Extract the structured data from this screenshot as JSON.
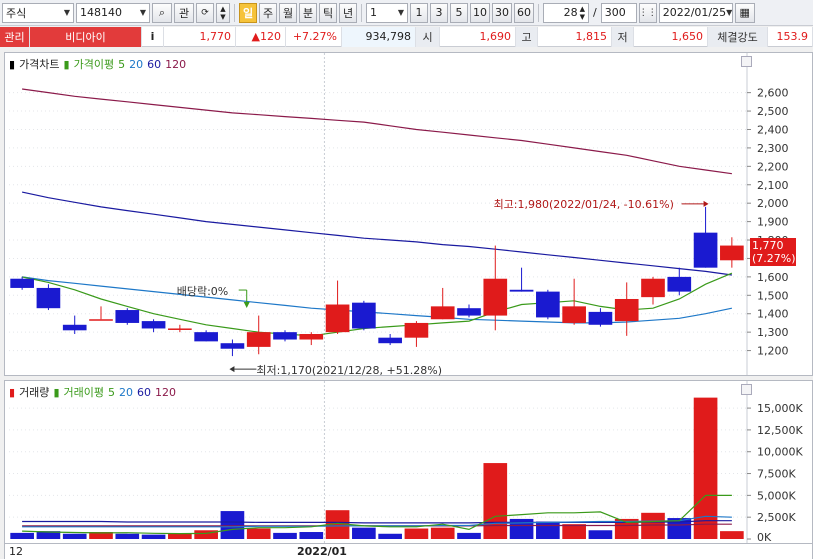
{
  "toolbar": {
    "market": "주식",
    "code": "148140",
    "btn_search": "⌕",
    "btn_fav": "관",
    "periods": [
      "일",
      "주",
      "월",
      "분",
      "틱",
      "년"
    ],
    "period_active": "일",
    "interval_value": "1",
    "interval_presets": [
      "1",
      "3",
      "5",
      "10",
      "30",
      "60"
    ],
    "count_value": "28",
    "count_sep": "/",
    "count_max": "300",
    "date": "2022/01/25"
  },
  "infobar": {
    "tag": "관리",
    "name": "비디아이",
    "info_btn": "i",
    "price": "1,770",
    "change": "▲120",
    "change_pct": "+7.27%",
    "volume": "934,798",
    "open_label": "시",
    "open": "1,690",
    "high_label": "고",
    "high": "1,815",
    "low_label": "저",
    "low": "1,650",
    "strength_label": "체결강도",
    "strength": "153.9"
  },
  "price_panel": {
    "legend_title": "가격차트",
    "legend_ma_label": "가격이평",
    "ma_periods": [
      "5",
      "20",
      "60",
      "120"
    ],
    "ma_colors": [
      "#3a9a1a",
      "#1e78c8",
      "#1a1aa0",
      "#8b1a4a"
    ],
    "annotation_high": "최고:1,980(2022/01/24, -10.61%)",
    "annotation_low": "최저:1,170(2021/12/28, +51.28%)",
    "annotation_dividend": "배당락:0%",
    "current_price_label": "1,770",
    "current_pct_label": "(7.27%)"
  },
  "volume_panel": {
    "legend_title": "거래량",
    "legend_ma_label": "거래이평",
    "ma_periods": [
      "5",
      "20",
      "60",
      "120"
    ]
  },
  "date_axis": {
    "left_label": "12",
    "month_label": "2022/01"
  },
  "colors": {
    "up": "#e01b1b",
    "down": "#1a1ad0"
  },
  "chart_data": [
    {
      "type": "candlestick",
      "ylim": [
        1100,
        2750
      ],
      "y_ticks": [
        "1,200",
        "1,300",
        "1,400",
        "1,500",
        "1,600",
        "1,700",
        "1,800",
        "1,900",
        "2,000",
        "2,100",
        "2,200",
        "2,300",
        "2,400",
        "2,500",
        "2,600"
      ],
      "y_tick_values": [
        1200,
        1300,
        1400,
        1500,
        1600,
        1700,
        1800,
        1900,
        2000,
        2100,
        2200,
        2300,
        2400,
        2500,
        2600
      ],
      "candles": [
        {
          "o": 1590,
          "h": 1600,
          "l": 1530,
          "c": 1540
        },
        {
          "o": 1540,
          "h": 1560,
          "l": 1420,
          "c": 1430
        },
        {
          "o": 1340,
          "h": 1390,
          "l": 1290,
          "c": 1310
        },
        {
          "o": 1370,
          "h": 1440,
          "l": 1370,
          "c": 1370
        },
        {
          "o": 1420,
          "h": 1430,
          "l": 1340,
          "c": 1350
        },
        {
          "o": 1360,
          "h": 1370,
          "l": 1300,
          "c": 1320
        },
        {
          "o": 1320,
          "h": 1340,
          "l": 1300,
          "c": 1320
        },
        {
          "o": 1300,
          "h": 1310,
          "l": 1250,
          "c": 1250
        },
        {
          "o": 1240,
          "h": 1260,
          "l": 1170,
          "c": 1210
        },
        {
          "o": 1220,
          "h": 1390,
          "l": 1180,
          "c": 1300
        },
        {
          "o": 1300,
          "h": 1310,
          "l": 1250,
          "c": 1260
        },
        {
          "o": 1260,
          "h": 1300,
          "l": 1230,
          "c": 1290
        },
        {
          "o": 1300,
          "h": 1580,
          "l": 1290,
          "c": 1450
        },
        {
          "o": 1460,
          "h": 1470,
          "l": 1310,
          "c": 1320
        },
        {
          "o": 1270,
          "h": 1290,
          "l": 1230,
          "c": 1240
        },
        {
          "o": 1270,
          "h": 1360,
          "l": 1220,
          "c": 1350
        },
        {
          "o": 1370,
          "h": 1540,
          "l": 1370,
          "c": 1440
        },
        {
          "o": 1430,
          "h": 1450,
          "l": 1380,
          "c": 1390
        },
        {
          "o": 1390,
          "h": 1770,
          "l": 1310,
          "c": 1590
        },
        {
          "o": 1530,
          "h": 1650,
          "l": 1520,
          "c": 1520
        },
        {
          "o": 1520,
          "h": 1530,
          "l": 1370,
          "c": 1380
        },
        {
          "o": 1350,
          "h": 1590,
          "l": 1340,
          "c": 1440
        },
        {
          "o": 1410,
          "h": 1430,
          "l": 1330,
          "c": 1340
        },
        {
          "o": 1360,
          "h": 1570,
          "l": 1280,
          "c": 1480
        },
        {
          "o": 1490,
          "h": 1600,
          "l": 1450,
          "c": 1590
        },
        {
          "o": 1600,
          "h": 1650,
          "l": 1500,
          "c": 1520
        },
        {
          "o": 1840,
          "h": 1980,
          "l": 1650,
          "c": 1650
        },
        {
          "o": 1690,
          "h": 1815,
          "l": 1650,
          "c": 1770
        }
      ],
      "ma5": [
        1600,
        1570,
        1530,
        1480,
        1440,
        1400,
        1370,
        1340,
        1320,
        1300,
        1290,
        1280,
        1300,
        1320,
        1330,
        1340,
        1350,
        1360,
        1410,
        1450,
        1460,
        1470,
        1440,
        1420,
        1430,
        1480,
        1560,
        1620
      ],
      "ma20": [
        1600,
        1580,
        1565,
        1550,
        1535,
        1520,
        1505,
        1490,
        1475,
        1460,
        1445,
        1430,
        1420,
        1410,
        1400,
        1390,
        1380,
        1370,
        1365,
        1360,
        1355,
        1350,
        1350,
        1355,
        1365,
        1375,
        1400,
        1430
      ],
      "ma60": [
        2060,
        2030,
        2005,
        1980,
        1960,
        1940,
        1920,
        1900,
        1885,
        1870,
        1855,
        1840,
        1825,
        1810,
        1800,
        1790,
        1775,
        1765,
        1750,
        1735,
        1720,
        1705,
        1690,
        1675,
        1660,
        1645,
        1630,
        1610
      ],
      "ma120": [
        2620,
        2600,
        2580,
        2565,
        2550,
        2535,
        2520,
        2505,
        2490,
        2480,
        2470,
        2460,
        2450,
        2440,
        2420,
        2400,
        2385,
        2370,
        2355,
        2340,
        2320,
        2300,
        2280,
        2260,
        2230,
        2200,
        2180,
        2160
      ]
    },
    {
      "type": "bar",
      "ylim": [
        0,
        16500
      ],
      "y_ticks": [
        "0K",
        "2,500K",
        "5,000K",
        "7,500K",
        "10,000K",
        "12,500K",
        "15,000K"
      ],
      "y_tick_values": [
        0,
        2500,
        5000,
        7500,
        10000,
        12500,
        15000
      ],
      "unit": "K",
      "values": [
        700,
        900,
        600,
        800,
        600,
        500,
        600,
        1000,
        3200,
        1200,
        700,
        800,
        3300,
        1300,
        600,
        1200,
        1300,
        700,
        8700,
        2300,
        2000,
        1700,
        1000,
        2300,
        3000,
        2400,
        16200,
        900
      ],
      "up": [
        false,
        false,
        false,
        true,
        false,
        false,
        true,
        true,
        false,
        true,
        false,
        false,
        true,
        false,
        false,
        true,
        true,
        false,
        true,
        false,
        false,
        true,
        false,
        true,
        true,
        false,
        true,
        true
      ],
      "ma5": [
        900,
        800,
        750,
        700,
        720,
        650,
        620,
        640,
        1100,
        1300,
        1300,
        1400,
        1800,
        1500,
        1400,
        1400,
        1700,
        1100,
        2600,
        2800,
        3000,
        3000,
        3100,
        1900,
        2000,
        2100,
        5000,
        5000
      ],
      "ma20": [
        1400,
        1400,
        1400,
        1400,
        1400,
        1400,
        1400,
        1400,
        1400,
        1450,
        1450,
        1450,
        1500,
        1500,
        1500,
        1500,
        1550,
        1550,
        1800,
        1850,
        1900,
        1950,
        2000,
        2000,
        2050,
        2100,
        2600,
        2500
      ],
      "ma60": [
        2000,
        2000,
        2000,
        2000,
        1950,
        1950,
        1950,
        1950,
        1950,
        1900,
        1900,
        1900,
        1900,
        1850,
        1850,
        1850,
        1850,
        1850,
        1900,
        1900,
        1900,
        1900,
        1900,
        1900,
        1950,
        1950,
        2100,
        2100
      ],
      "ma120": [
        1500,
        1500,
        1500,
        1500,
        1500,
        1500,
        1500,
        1500,
        1500,
        1500,
        1500,
        1500,
        1500,
        1500,
        1500,
        1500,
        1500,
        1500,
        1550,
        1550,
        1550,
        1550,
        1550,
        1550,
        1600,
        1600,
        1700,
        1700
      ]
    }
  ]
}
